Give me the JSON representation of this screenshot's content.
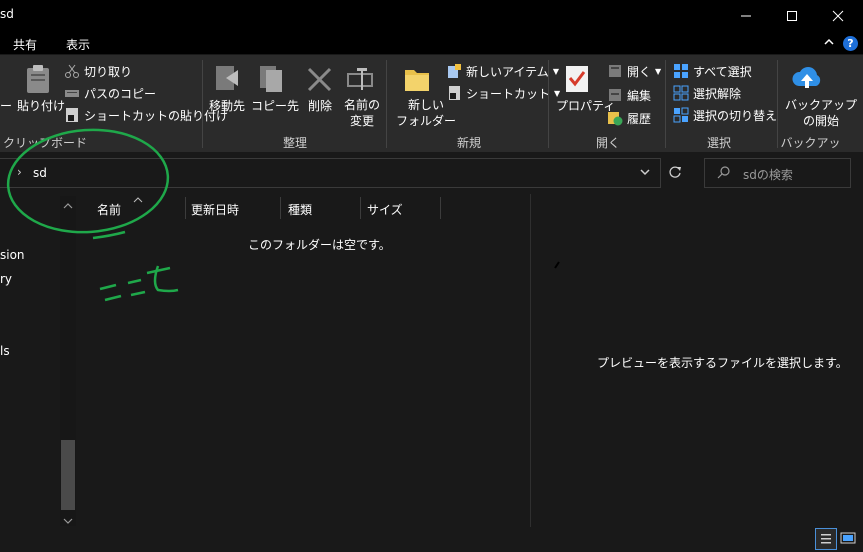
{
  "window": {
    "title": "sd"
  },
  "menu": {
    "tabs": [
      "共有",
      "表示"
    ]
  },
  "ribbon": {
    "clipboard": {
      "paste_label": "貼り付け",
      "pin_fragment": "ー",
      "cut": "切り取り",
      "copy_path": "パスのコピー",
      "paste_shortcut": "ショートカットの貼り付け",
      "label": "クリップボード"
    },
    "organize": {
      "move_to": "移動先",
      "copy_to": "コピー先",
      "delete": "削除",
      "rename_line1": "名前の",
      "rename_line2": "変更",
      "label": "整理"
    },
    "new": {
      "new_folder_line1": "新しい",
      "new_folder_line2": "フォルダー",
      "new_item": "新しいアイテム",
      "shortcut": "ショートカット",
      "label": "新規"
    },
    "open": {
      "properties": "プロパティ",
      "open": "開く",
      "edit": "編集",
      "history": "履歴",
      "label": "開く"
    },
    "select": {
      "select_all": "すべて選択",
      "select_none": "選択解除",
      "invert": "選択の切り替え",
      "label": "選択"
    },
    "backup": {
      "start_line1": "バックアップ",
      "start_line2": "の開始",
      "label": "バックアップ"
    }
  },
  "address": {
    "path": "sd",
    "search_placeholder": "sdの検索"
  },
  "nav": {
    "items": [
      "sion",
      "ry",
      "ls"
    ]
  },
  "columns": [
    "名前",
    "更新日時",
    "種類",
    "サイズ"
  ],
  "content": {
    "empty_message": "このフォルダーは空です。"
  },
  "preview": {
    "message": "プレビューを表示するファイルを選択します。"
  },
  "annotation": {
    "handwritten": "ここも"
  },
  "colors": {
    "accent": "#0a84ff",
    "annotation": "#1fa84a"
  }
}
